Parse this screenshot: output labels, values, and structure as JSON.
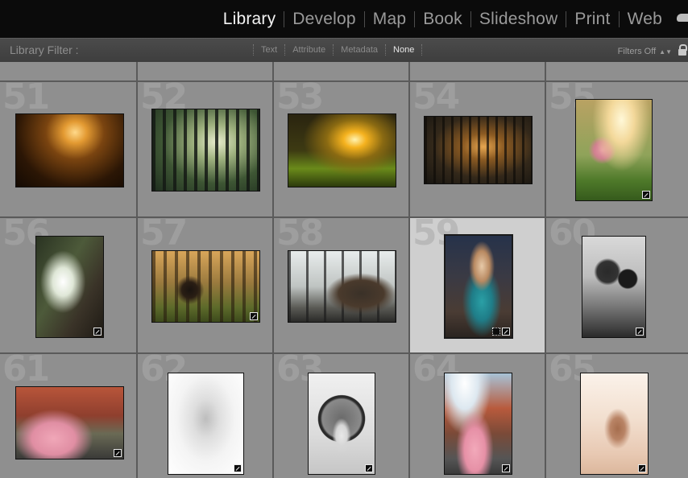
{
  "modules": {
    "items": [
      "Library",
      "Develop",
      "Map",
      "Book",
      "Slideshow",
      "Print",
      "Web"
    ],
    "active": "Library",
    "icon": "cloud-icon"
  },
  "filter_bar": {
    "title": "Library Filter :",
    "options": [
      "Text",
      "Attribute",
      "Metadata",
      "None"
    ],
    "active": "None",
    "filters_label": "Filters Off",
    "lock_icon": "lock-icon"
  },
  "grid": {
    "selected": "59",
    "cells": [
      {
        "num": "51",
        "subject": "golden bokeh sunset"
      },
      {
        "num": "52",
        "subject": "misty forest rays"
      },
      {
        "num": "53",
        "subject": "sun flare forest path"
      },
      {
        "num": "54",
        "subject": "dark forest sunrise"
      },
      {
        "num": "55",
        "subject": "girl in meadow"
      },
      {
        "num": "56",
        "subject": "girl under tree"
      },
      {
        "num": "57",
        "subject": "woman in forest"
      },
      {
        "num": "58",
        "subject": "man with laptop"
      },
      {
        "num": "59",
        "subject": "woman with radio"
      },
      {
        "num": "60",
        "subject": "woman with records"
      },
      {
        "num": "61",
        "subject": "woman by pink car"
      },
      {
        "num": "62",
        "subject": "bride in white"
      },
      {
        "num": "63",
        "subject": "woman in circle"
      },
      {
        "num": "64",
        "subject": "pink car street"
      },
      {
        "num": "65",
        "subject": "woman in long dress"
      }
    ]
  },
  "colors": {
    "cell": "#8f8f8f",
    "cell_selected": "#cfcfcf",
    "grid_bg": "#5a5a5a",
    "module_active": "#f4f4f4",
    "module_inactive": "#9a9a9a"
  }
}
